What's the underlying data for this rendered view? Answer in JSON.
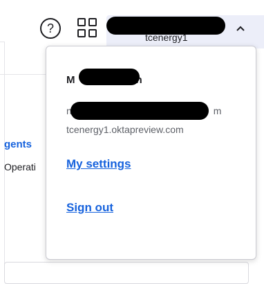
{
  "header": {
    "help_icon": "help-circle-icon",
    "apps_icon": "app-grid-icon",
    "org_label": "tcenergy1",
    "chevron": "^"
  },
  "background": {
    "partial_link": "gents",
    "partial_text": "Operati"
  },
  "dropdown": {
    "name_start": "M",
    "name_end": "h",
    "email_start": "n",
    "email_end": "m",
    "domain": "tcenergy1.oktapreview.com",
    "my_settings": "My settings",
    "sign_out": "Sign out"
  },
  "colors": {
    "link": "#1662dd",
    "menu_bg": "#eceef9",
    "text": "#1d1d21",
    "muted": "#5c5f66"
  }
}
